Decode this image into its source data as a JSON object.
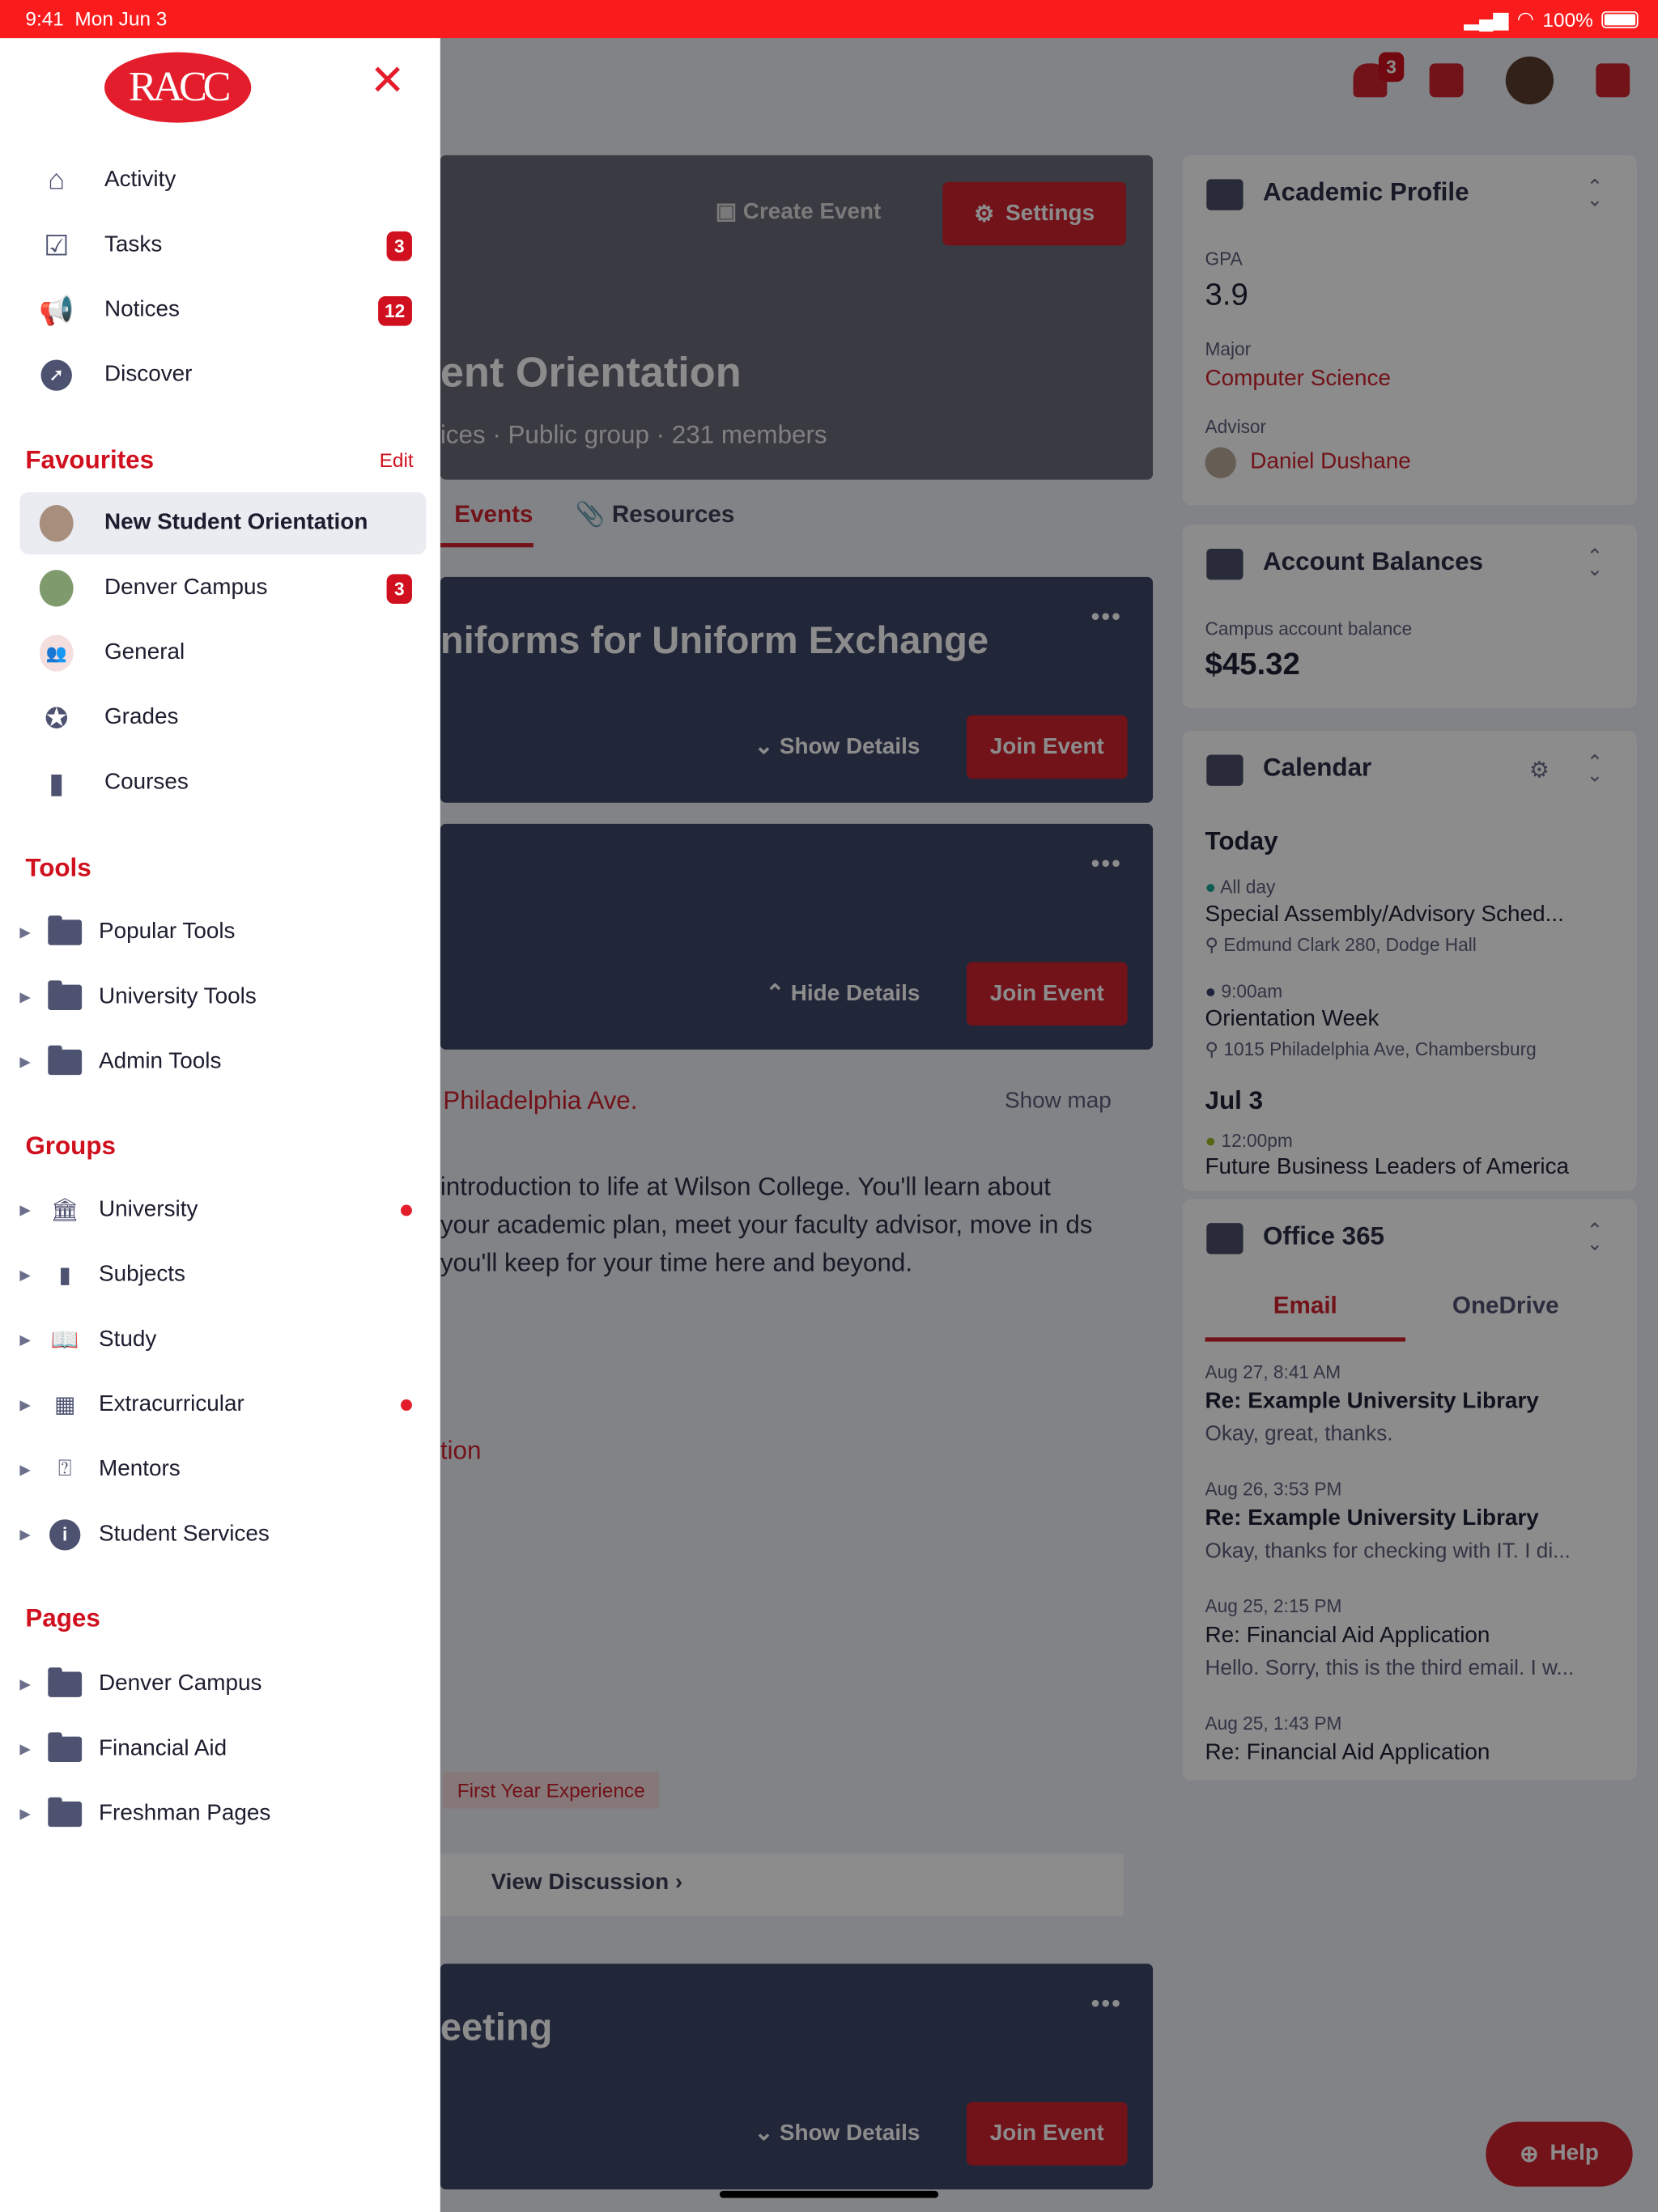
{
  "status_bar": {
    "time": "9:41",
    "date": "Mon Jun 3",
    "battery": "100%",
    "battery_level": 1.0
  },
  "drawer": {
    "logo_text": "RACC",
    "nav": [
      {
        "label": "Activity",
        "icon": "home-icon"
      },
      {
        "label": "Tasks",
        "icon": "tasks-icon",
        "badge": "3"
      },
      {
        "label": "Notices",
        "icon": "megaphone-icon",
        "badge": "12"
      },
      {
        "label": "Discover",
        "icon": "compass-icon"
      }
    ],
    "favourites": {
      "title": "Favourites",
      "edit": "Edit",
      "items": [
        {
          "label": "New Student Orientation",
          "selected": true
        },
        {
          "label": "Denver Campus",
          "badge": "3"
        },
        {
          "label": "General"
        },
        {
          "label": "Grades"
        },
        {
          "label": "Courses"
        }
      ]
    },
    "tools": {
      "title": "Tools",
      "items": [
        {
          "label": "Popular Tools"
        },
        {
          "label": "University Tools"
        },
        {
          "label": "Admin Tools"
        }
      ]
    },
    "groups": {
      "title": "Groups",
      "items": [
        {
          "label": "University",
          "unread": true
        },
        {
          "label": "Subjects"
        },
        {
          "label": "Study"
        },
        {
          "label": "Extracurricular",
          "unread": true
        },
        {
          "label": "Mentors"
        },
        {
          "label": "Student Services"
        }
      ]
    },
    "pages": {
      "title": "Pages",
      "items": [
        {
          "label": "Denver Campus"
        },
        {
          "label": "Financial Aid"
        },
        {
          "label": "Freshman Pages"
        }
      ]
    }
  },
  "header": {
    "notification_badge": "3"
  },
  "group": {
    "title": "ent Orientation",
    "meta": "ices  ·  Public group  ·  231 members",
    "create_event": "Create Event",
    "settings": "Settings"
  },
  "tabs": {
    "events": "Events",
    "resources": "Resources"
  },
  "events": [
    {
      "title": "niforms for Uniform Exchange",
      "details": "Show Details",
      "join": "Join Event"
    },
    {
      "title": "",
      "details": "Hide Details",
      "join": "Join Event"
    },
    {
      "title": "eeting",
      "details": "Show Details",
      "join": "Join Event"
    }
  ],
  "event_detail": {
    "address": "Philadelphia Ave.",
    "show_map": "Show map",
    "description": " introduction to life at Wilson College. You'll learn about your academic plan, meet your faculty advisor, move in ds you'll keep for your time here and beyond.",
    "section": "tion",
    "tag": "First Year Experience",
    "view_discussion": "View Discussion"
  },
  "academic_profile": {
    "title": "Academic Profile",
    "gpa_label": "GPA",
    "gpa": "3.9",
    "major_label": "Major",
    "major": "Computer Science",
    "advisor_label": "Advisor",
    "advisor": "Daniel Dushane"
  },
  "account_balances": {
    "title": "Account Balances",
    "label": "Campus account balance",
    "value": "$45.32"
  },
  "calendar": {
    "title": "Calendar",
    "today": "Today",
    "events": [
      {
        "time": "All day",
        "title": "Special Assembly/Advisory Sched...",
        "location": "Edmund Clark 280, Dodge Hall",
        "color": "#1aa59a"
      },
      {
        "time": "9:00am",
        "title": "Orientation Week",
        "location": "1015 Philadelphia Ave, Chambersburg",
        "color": "#3a3d6b"
      }
    ],
    "next_day": "Jul 3",
    "next_event": {
      "time": "12:00pm",
      "title": "Future Business Leaders of America",
      "color": "#9bbb2a"
    }
  },
  "office365": {
    "title": "Office 365",
    "tabs": [
      "Email",
      "OneDrive"
    ],
    "emails": [
      {
        "date": "Aug 27, 8:41 AM",
        "subject": "Re: Example University Library",
        "preview": "Okay, great, thanks.",
        "unread": true
      },
      {
        "date": "Aug 26, 3:53 PM",
        "subject": "Re: Example University Library",
        "preview": "Okay, thanks for checking with IT. I di...",
        "unread": true
      },
      {
        "date": "Aug 25, 2:15 PM",
        "subject": "Re: Financial Aid Application",
        "preview": "Hello. Sorry, this is the third email. I w...",
        "unread": false
      },
      {
        "date": "Aug 25, 1:43 PM",
        "subject": "Re: Financial Aid Application",
        "preview": "",
        "unread": false
      }
    ]
  },
  "help": "Help",
  "colors": {
    "accent": "#d0101e",
    "status_bar": "#fa1c1c",
    "icon": "#4e5271"
  }
}
